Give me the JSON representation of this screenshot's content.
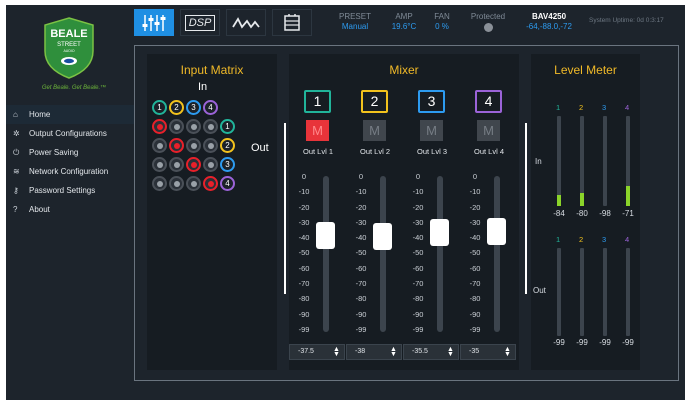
{
  "brand": {
    "logo_line1": "BEALE",
    "logo_line2": "STREET",
    "logo_line3": "AUDIO",
    "tagline": "Get Beale. Get Beale.™"
  },
  "nav": [
    {
      "label": "Home",
      "icon": "home-icon",
      "glyph": "⌂"
    },
    {
      "label": "Output Configurations",
      "icon": "gear-icon",
      "glyph": "✲"
    },
    {
      "label": "Power Saving",
      "icon": "power-icon",
      "glyph": "⏻"
    },
    {
      "label": "Network Configuration",
      "icon": "wifi-icon",
      "glyph": "≋"
    },
    {
      "label": "Password Settings",
      "icon": "key-icon",
      "glyph": "⚷"
    },
    {
      "label": "About",
      "icon": "question-icon",
      "glyph": "?"
    }
  ],
  "toolbar": {
    "dsp_label": "DSP"
  },
  "status": {
    "preset_label": "PRESET",
    "preset_value": "Manual",
    "amp_label": "AMP",
    "amp_value": "19.6°C",
    "fan_label": "FAN",
    "fan_value": "0 %",
    "protected_label": "Protected",
    "model_label": "BAV4250",
    "model_value": "-64,-88.0,-72",
    "uptime": "System Uptime: 0d 0:3:17"
  },
  "matrix": {
    "title": "Input Matrix",
    "in_label": "In",
    "out_label": "Out",
    "inputs": [
      "1",
      "2",
      "3",
      "4"
    ],
    "outputs": [
      "1",
      "2",
      "3",
      "4"
    ],
    "routing": [
      [
        1,
        0,
        0,
        0
      ],
      [
        0,
        1,
        0,
        0
      ],
      [
        0,
        0,
        1,
        0
      ],
      [
        0,
        0,
        0,
        1
      ]
    ]
  },
  "mixer": {
    "title": "Mixer",
    "mute_label": "M",
    "scale": [
      "0",
      "-10",
      "-20",
      "-30",
      "-40",
      "-50",
      "-60",
      "-70",
      "-80",
      "-90",
      "-99"
    ],
    "spin_glyph": "▲▼",
    "channels": [
      {
        "num": "1",
        "label": "Out Lvl 1",
        "muted": true,
        "level": -37.5,
        "value": "-37.5"
      },
      {
        "num": "2",
        "label": "Out Lvl 2",
        "muted": false,
        "level": -38,
        "value": "-38"
      },
      {
        "num": "3",
        "label": "Out Lvl 3",
        "muted": false,
        "level": -35.5,
        "value": "-35.5"
      },
      {
        "num": "4",
        "label": "Out Lvl 4",
        "muted": false,
        "level": -35,
        "value": "-35"
      }
    ]
  },
  "levels": {
    "title": "Level Meter",
    "in_label": "In",
    "out_label": "Out",
    "channels": [
      "1",
      "2",
      "3",
      "4"
    ],
    "in_values": [
      "-84",
      "-80",
      "-98",
      "-71"
    ],
    "in_fill": [
      0.12,
      0.15,
      0.0,
      0.22
    ],
    "out_values": [
      "-99",
      "-99",
      "-99",
      "-99"
    ],
    "out_fill": [
      0,
      0,
      0,
      0
    ]
  },
  "colors": {
    "ch1": "#21b49a",
    "ch2": "#f2c21d",
    "ch3": "#2d9bf0",
    "ch4": "#9b63d8",
    "accent": "#1f8fe3",
    "title": "#f0b928",
    "mute_on": "#e8343a",
    "meter": "#8bd42a"
  }
}
